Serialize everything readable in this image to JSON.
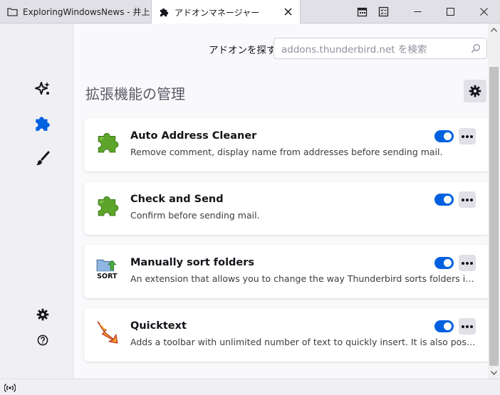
{
  "tabs": {
    "inactive": {
      "label": "ExploringWindowsNews - 井上"
    },
    "active": {
      "label": "アドオンマネージャー"
    }
  },
  "header": {
    "find_label": "アドオンを探す",
    "search_placeholder": "addons.thunderbird.net を検索"
  },
  "page_title": "拡張機能の管理",
  "sidebar": {
    "items": [
      {
        "name": "recommendations",
        "icon": "sparkle-icon"
      },
      {
        "name": "extensions",
        "icon": "puzzle-icon",
        "active": true
      },
      {
        "name": "themes",
        "icon": "brush-icon"
      }
    ],
    "bottom": [
      {
        "name": "settings",
        "icon": "gear-icon"
      },
      {
        "name": "help",
        "icon": "help-icon"
      }
    ]
  },
  "extensions": [
    {
      "name": "Auto Address Cleaner",
      "description": "Remove comment, display name from addresses before sending mail.",
      "icon": "puzzle-green-icon",
      "enabled": true
    },
    {
      "name": "Check and Send",
      "description": "Confirm before sending mail.",
      "icon": "puzzle-green-icon",
      "enabled": true
    },
    {
      "name": "Manually sort folders",
      "description": "An extension that allows you to change the way Thunderbird sorts folders in ...",
      "icon": "sort-folders-icon",
      "icon_text": "SORT",
      "enabled": true
    },
    {
      "name": "Quicktext",
      "description": "Adds a toolbar with unlimited number of text to quickly insert. It is also possi...",
      "icon": "quicktext-bolt-icon",
      "enabled": true
    }
  ],
  "colors": {
    "accent": "#0061e0",
    "addon_green": "#5da42a",
    "titlebar": "#e0e0e6"
  }
}
